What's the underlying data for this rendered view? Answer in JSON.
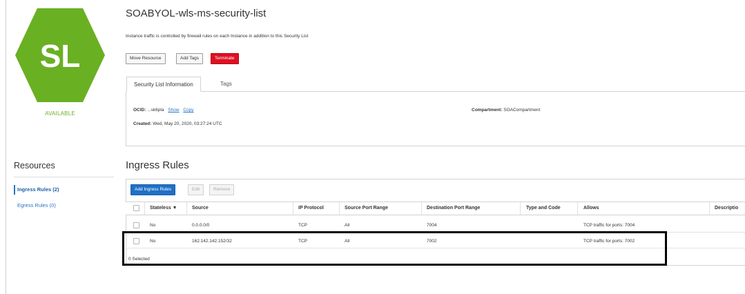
{
  "resource": {
    "badge": "SL",
    "badge_color": "#6ab023",
    "status": "AVAILABLE",
    "status_color": "#6ab023",
    "title": "SOABYOL-wls-ms-security-list",
    "description": "Instance traffic is controlled by firewall rules on each Instance in addition to this Security List"
  },
  "actions": {
    "move": "Move Resource",
    "tags": "Add Tags",
    "terminate": "Terminate"
  },
  "tabs": {
    "info": "Security List Information",
    "tags": "Tags"
  },
  "info": {
    "ocid_label": "OCID:",
    "ocid_value": "...sk6pla",
    "show": "Show",
    "copy": "Copy",
    "created_label": "Created:",
    "created_value": "Wed, May 20, 2020, 03:27:24 UTC",
    "compartment_label": "Compartment:",
    "compartment_value": "SOACompartment"
  },
  "resources": {
    "title": "Resources",
    "items": [
      {
        "label": "Ingress Rules (2)",
        "active": true
      },
      {
        "label": "Egress Rules (0)",
        "active": false
      }
    ]
  },
  "ingress": {
    "title": "Ingress Rules",
    "add": "Add Ingress Rules",
    "edit": "Edit",
    "remove": "Remove",
    "columns": [
      "Stateless ▼",
      "Source",
      "IP Protocol",
      "Source Port Range",
      "Destination Port Range",
      "Type and Code",
      "Allows",
      "Descriptio"
    ],
    "rows": [
      {
        "stateless": "No",
        "source": "0.0.0.0/0",
        "protocol": "TCP",
        "src_port": "All",
        "dst_port": "7004",
        "type_code": "",
        "allows": "TCP traffic for ports: 7004",
        "description": ""
      },
      {
        "stateless": "No",
        "source": "162.142.142.152/32",
        "protocol": "TCP",
        "src_port": "All",
        "dst_port": "7002",
        "type_code": "",
        "allows": "TCP traffic for ports: 7002",
        "description": ""
      }
    ],
    "selected": "0 Selected"
  }
}
